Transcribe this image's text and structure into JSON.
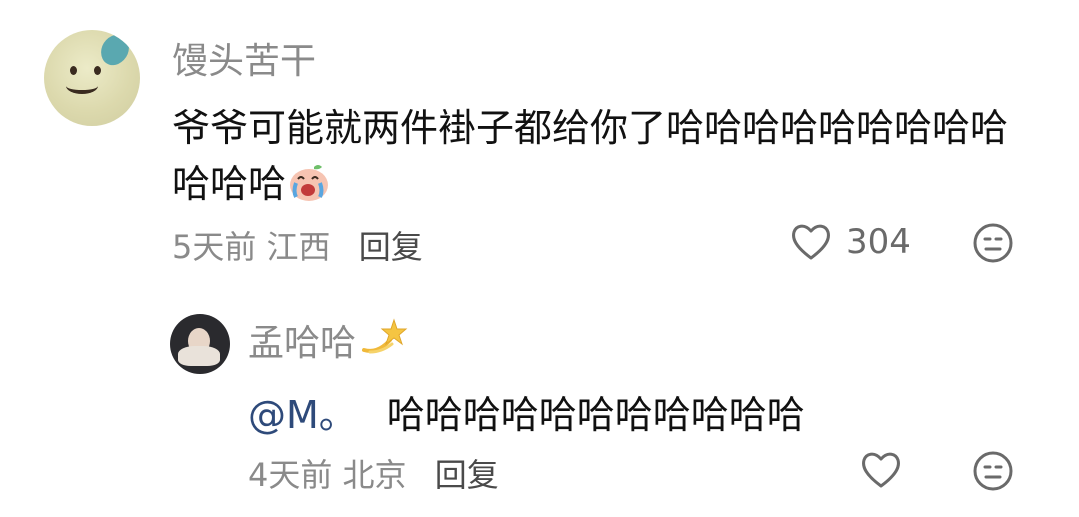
{
  "comment": {
    "username": "馒头苦干",
    "text": "爷爷可能就两件褂子都给你了哈哈哈哈哈哈哈哈哈哈哈哈",
    "emoji": "crying-laughing-peach-emoji",
    "time": "5天前",
    "location": "江西",
    "reply_label": "回复",
    "like_count": "304"
  },
  "reply": {
    "username": "孟哈哈",
    "username_emoji": "dizzy-star-emoji",
    "mention": "@M。",
    "text": "哈哈哈哈哈哈哈哈哈哈哈",
    "time": "4天前",
    "location": "北京",
    "reply_label": "回复"
  },
  "colors": {
    "meta_text": "#8a8a8a",
    "mention": "#2e4a7a",
    "body_text": "#111111"
  }
}
